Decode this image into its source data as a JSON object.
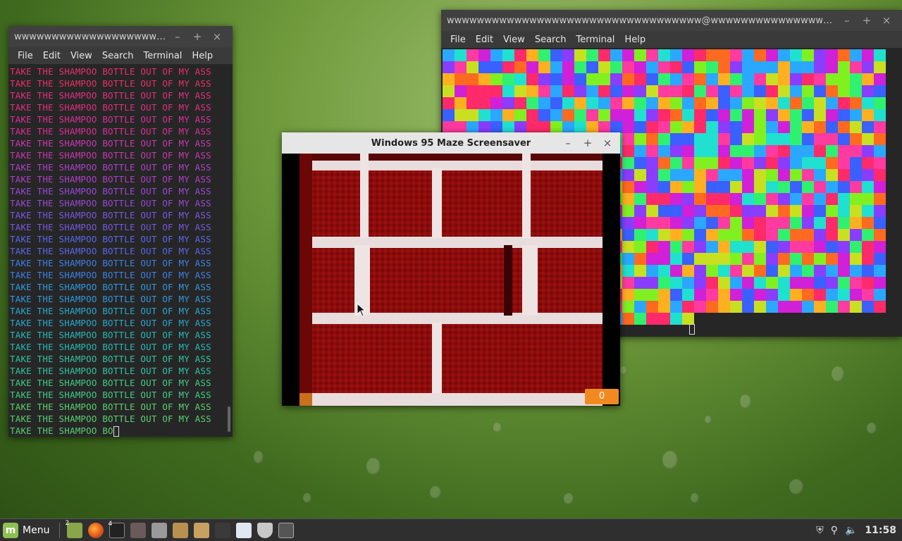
{
  "desktop": {
    "wallpaper": "green-raindrops"
  },
  "left_terminal": {
    "title": "wwwwwwwwwwwwwwwwwwwww...",
    "menu": [
      "File",
      "Edit",
      "View",
      "Search",
      "Terminal",
      "Help"
    ],
    "repeated_line": "TAKE THE SHAMPOO BOTTLE OUT OF MY ASS",
    "line_count": 30,
    "partial_line": "TAKE THE SHAMPOO BO",
    "colors": [
      "#e8306a",
      "#e03080",
      "#d83098",
      "#c838b0",
      "#b040c8",
      "#9848d8",
      "#7858e0",
      "#5868e8",
      "#3c80e8",
      "#3098e0",
      "#28a8d0",
      "#28b8b8",
      "#30c4a0",
      "#40cc88",
      "#58d070"
    ]
  },
  "right_terminal": {
    "title": "wwwwwwwwwwwwwwwwwwwwwwwwwwwwwwwwww@wwwwwwwwwwwwwwwwwwwww",
    "menu": [
      "File",
      "Edit",
      "View",
      "Search",
      "Terminal",
      "Help"
    ],
    "palette": [
      "#ff2a6a",
      "#ff3aa0",
      "#d020d8",
      "#8a3cff",
      "#3a60ff",
      "#2aa8ff",
      "#20e0d0",
      "#30f070",
      "#80f020",
      "#c8e020",
      "#ffb020",
      "#ff6a20"
    ]
  },
  "maze_window": {
    "title": "Windows 95 Maze Screensaver",
    "score": "0"
  },
  "window_controls": {
    "minimize": "–",
    "maximize": "+",
    "close": "×"
  },
  "taskbar": {
    "menu_label": "Menu",
    "workspace_badge": "2",
    "terminal_badge": "4",
    "clock": "11:58"
  }
}
